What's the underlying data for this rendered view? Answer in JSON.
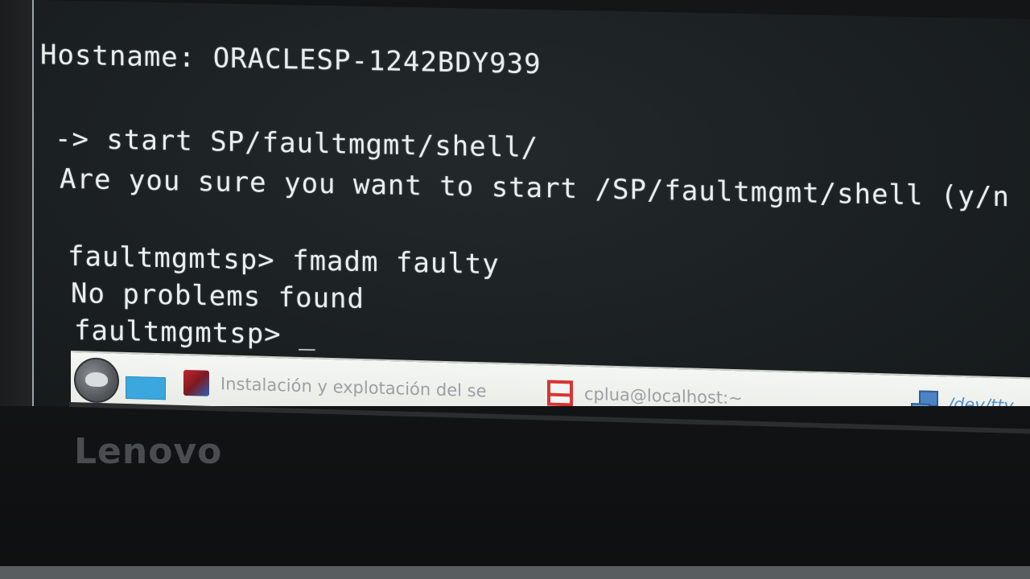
{
  "terminal": {
    "hostname_line": "Hostname: ORACLESP-1242BDY939",
    "command_line": "-> start SP/faultmgmt/shell/",
    "confirm_line": "Are you sure you want to start /SP/faultmgmt/shell (y/n",
    "fmadm_line": "faultmgmtsp> fmadm faulty",
    "result_line": "No problems found",
    "prompt_line": "faultmgmtsp> ",
    "cursor": "_"
  },
  "taskbar": {
    "start_icon": "start-menu-icon",
    "show_desktop_icon": "show-desktop-icon",
    "task1_label": "Instalación y explotación del se",
    "task1_icon": "browser-icon",
    "task2_label": "cplua@localhost:~",
    "task2_icon": "terminal-icon",
    "tray_label": "/dev/tty",
    "tray_icon": "network-icon"
  },
  "monitor": {
    "brand": "Lenovo"
  }
}
